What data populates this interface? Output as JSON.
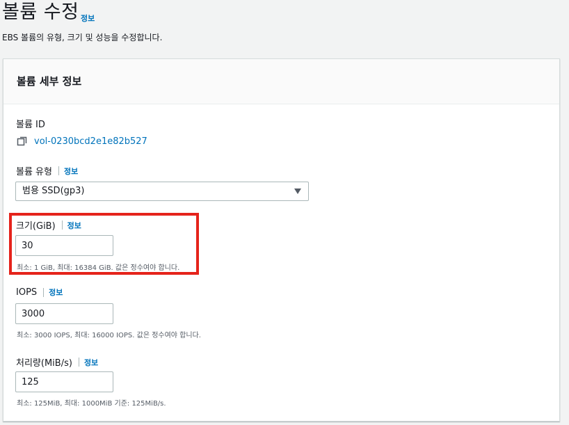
{
  "page": {
    "title": "볼륨 수정",
    "info_label": "정보",
    "description": "EBS 볼륨의 유형, 크기 및 성능을 수정합니다."
  },
  "panel": {
    "title": "볼륨 세부 정보"
  },
  "volume_id": {
    "label": "볼륨 ID",
    "value": "vol-0230bcd2e1e82b527",
    "icon": "copy-icon"
  },
  "volume_type": {
    "label": "볼륨 유형",
    "info_label": "정보",
    "selected": "범용 SSD(gp3)"
  },
  "size": {
    "label": "크기(GiB)",
    "info_label": "정보",
    "value": "30",
    "hint": "최소: 1 GiB, 최대: 16384 GiB. 값은 정수여야 합니다."
  },
  "iops": {
    "label": "IOPS",
    "info_label": "정보",
    "value": "3000",
    "hint": "최소: 3000 IOPS, 최대: 16000 IOPS. 값은 정수여야 합니다."
  },
  "throughput": {
    "label": "처리량(MiB/s)",
    "info_label": "정보",
    "value": "125",
    "hint": "최소: 125MiB, 최대: 1000MiB 기준: 125MiB/s."
  },
  "colors": {
    "link": "#0073bb",
    "highlight": "#e5231b"
  }
}
